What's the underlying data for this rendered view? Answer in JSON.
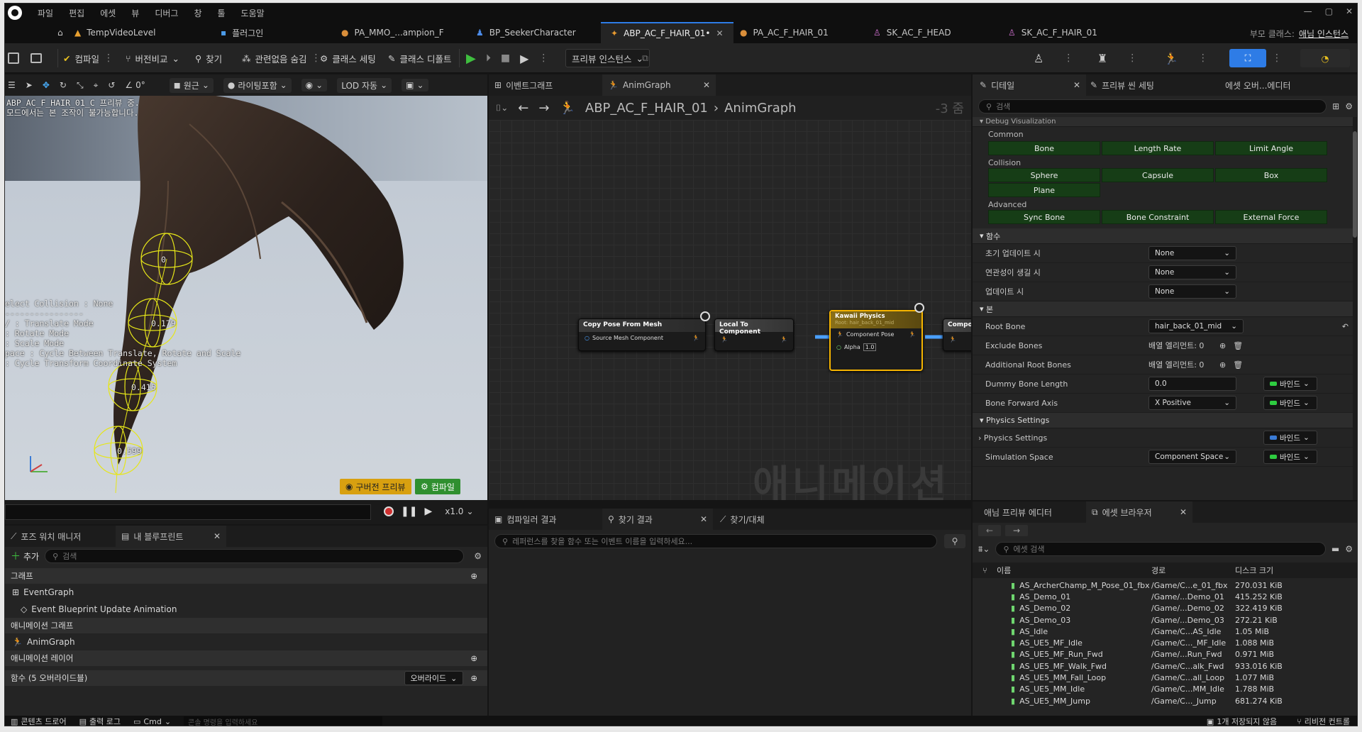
{
  "menu": [
    "파일",
    "편집",
    "에셋",
    "뷰",
    "디버그",
    "창",
    "툴",
    "도움말"
  ],
  "doc_tabs": [
    {
      "label": "TempVideoLevel",
      "active": false
    },
    {
      "label": "플러그인",
      "active": false
    },
    {
      "label": "PA_MMO_...ampion_F",
      "active": false
    },
    {
      "label": "BP_SeekerCharacter",
      "active": false
    },
    {
      "label": "ABP_AC_F_HAIR_01•",
      "active": true
    },
    {
      "label": "PA_AC_F_HAIR_01",
      "active": false
    },
    {
      "label": "SK_AC_F_HEAD",
      "active": false
    },
    {
      "label": "SK_AC_F_HAIR_01",
      "active": false
    }
  ],
  "parent_class": {
    "label": "부모 클래스:",
    "value": "애님 인스턴스"
  },
  "toolbar": {
    "compile": "컴파일",
    "diff": "버전비교",
    "find": "찾기",
    "hide_unrelated": "관련없음 숨김",
    "class_settings": "클래스 세팅",
    "class_defaults": "클래스 디폴트",
    "preview_instance": "프리뷰 인스턴스"
  },
  "viewport": {
    "toolbar": {
      "zoom": "0°",
      "perspective": "원근",
      "lighting": "라이팅포함",
      "lod": "LOD 자동"
    },
    "overlay_title": "ABP_AC_F_HAIR_01_C 프리뷰 중.",
    "overlay_sub": "모드에서는 본 조작이 불가능합니다.",
    "help_lines": [
      "elect Collision : None",
      "----------------",
      "/ : Translate Mode",
      ": Rotate Mode",
      ": Scale Mode",
      "pace : Cycle Between Translate, Rotate and Scale",
      ": Cycle Transform Coordinate System"
    ],
    "sphere_labels": [
      "0",
      "0.179",
      "0.415",
      "0.599"
    ],
    "old_preview_btn": "구버전 프리뷰",
    "compile_btn": "컴파일",
    "speed": "x1.0"
  },
  "graph": {
    "tabs": [
      "이벤트그래프",
      "AnimGraph"
    ],
    "breadcrumb": [
      "ABP_AC_F_HAIR_01",
      "AnimGraph"
    ],
    "zoom": "-3 줌",
    "watermark": "애니메이션",
    "nodes": {
      "copy_pose": {
        "title": "Copy Pose From Mesh",
        "pin": "Source Mesh Component"
      },
      "local_to_comp": {
        "title": "Local To Component"
      },
      "kawaii": {
        "title": "Kawaii Physics",
        "subtitle": "Root: hair_back_01_mid",
        "pin1": "Component Pose",
        "pin2": "Alpha",
        "alpha": "1.0"
      },
      "comp_to_local": {
        "title": "Compo"
      }
    }
  },
  "details": {
    "tabs": [
      "디테일",
      "프리뷰 씬 세팅",
      "에셋 오버...에디터"
    ],
    "search_placeholder": "검색",
    "debug_header": "Debug Visualization",
    "common": "Common",
    "common_btns": [
      "Bone",
      "Length Rate",
      "Limit Angle"
    ],
    "collision": "Collision",
    "collision_btns": [
      "Sphere",
      "Capsule",
      "Box"
    ],
    "plane": "Plane",
    "advanced": "Advanced",
    "advanced_btns": [
      "Sync Bone",
      "Bone Constraint",
      "External Force"
    ],
    "functions_header": "함수",
    "functions": [
      {
        "label": "초기 업데이트 시",
        "value": "None"
      },
      {
        "label": "연관성이 생길 시",
        "value": "None"
      },
      {
        "label": "업데이트 시",
        "value": "None"
      }
    ],
    "bone_header": "본",
    "root_bone": {
      "label": "Root Bone",
      "value": "hair_back_01_mid"
    },
    "exclude_bones": {
      "label": "Exclude Bones",
      "value": "배열 엘리먼트: 0"
    },
    "additional_root": {
      "label": "Additional Root Bones",
      "value": "배열 엘리먼트: 0"
    },
    "dummy_bone": {
      "label": "Dummy Bone Length",
      "value": "0.0",
      "bind": "바인드"
    },
    "forward_axis": {
      "label": "Bone Forward Axis",
      "value": "X Positive",
      "bind": "바인드"
    },
    "physics_header": "Physics Settings",
    "physics_settings": {
      "label": "Physics Settings",
      "bind": "바인드"
    },
    "sim_space": {
      "label": "Simulation Space",
      "value": "Component Space",
      "bind": "바인드"
    }
  },
  "mybp": {
    "tabs": [
      "포즈 워치 매니저",
      "내 블루프린트"
    ],
    "add": "추가",
    "search_placeholder": "검색",
    "cat_graph": "그래프",
    "event_graph": "EventGraph",
    "event_update": "Event Blueprint Update Animation",
    "cat_anim_graph": "애니메이션 그래프",
    "anim_graph": "AnimGraph",
    "cat_anim_layer": "애니메이션 레이어",
    "cat_functions": "함수 (5 오버라이드블)",
    "override": "오버라이드"
  },
  "compiler": {
    "tabs": [
      "컴파일러 결과",
      "찾기 결과",
      "찾기/대체"
    ],
    "search_placeholder": "레퍼런스를 찾을 함수 또는 이벤트 이름을 입력하세요..."
  },
  "asset_browser": {
    "tabs": [
      "애님 프리뷰 에디터",
      "에셋 브라우저"
    ],
    "search_placeholder": "에셋 검색",
    "columns": [
      "이름",
      "경로",
      "디스크 크기"
    ],
    "rows": [
      {
        "name": "AS_ArcherChamp_M_Pose_01_fbx",
        "path": "/Game/C...e_01_fbx",
        "size": "270.031 KiB"
      },
      {
        "name": "AS_Demo_01",
        "path": "/Game/...Demo_01",
        "size": "415.252 KiB"
      },
      {
        "name": "AS_Demo_02",
        "path": "/Game/...Demo_02",
        "size": "322.419 KiB"
      },
      {
        "name": "AS_Demo_03",
        "path": "/Game/...Demo_03",
        "size": "272.21 KiB"
      },
      {
        "name": "AS_Idle",
        "path": "/Game/C...AS_Idle",
        "size": "1.05 MiB"
      },
      {
        "name": "AS_UE5_MF_Idle",
        "path": "/Game/C..._MF_Idle",
        "size": "1.088 MiB"
      },
      {
        "name": "AS_UE5_MF_Run_Fwd",
        "path": "/Game/...Run_Fwd",
        "size": "0.971 MiB"
      },
      {
        "name": "AS_UE5_MF_Walk_Fwd",
        "path": "/Game/C...alk_Fwd",
        "size": "933.016 KiB"
      },
      {
        "name": "AS_UE5_MM_Fall_Loop",
        "path": "/Game/C...all_Loop",
        "size": "1.077 MiB"
      },
      {
        "name": "AS_UE5_MM_Idle",
        "path": "/Game/C...MM_Idle",
        "size": "1.788 MiB"
      },
      {
        "name": "AS_UE5_MM_Jump",
        "path": "/Game/C..._Jump",
        "size": "681.274 KiB"
      }
    ]
  },
  "status": {
    "content_drawer": "콘텐츠 드로어",
    "output_log": "출력 로그",
    "cmd": "Cmd",
    "cmd_placeholder": "콘솔 명령을 입력하세요",
    "unsaved": "1개 저장되지 않음",
    "revision": "리비전 컨트롤"
  },
  "colors": {
    "accent": "#2e7ce6",
    "play": "#3fbf3f",
    "node_kawaii": "#8a7018",
    "highlight": "#f5b400",
    "bind": "#2ecc40"
  }
}
